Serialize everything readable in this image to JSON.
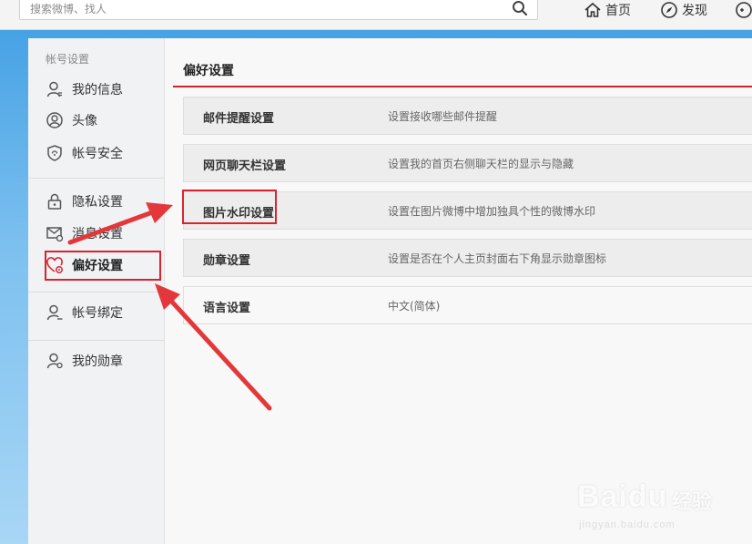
{
  "topbar": {
    "search_placeholder": "搜索微博、找人",
    "nav": [
      {
        "label": "首页",
        "icon": "home-icon"
      },
      {
        "label": "发现",
        "icon": "compass-icon"
      },
      {
        "label": "",
        "icon": "gamepad-icon"
      }
    ]
  },
  "sidebar": {
    "group_title": "帐号设置",
    "items": [
      {
        "label": "我的信息",
        "icon": "user-icon"
      },
      {
        "label": "头像",
        "icon": "avatar-icon"
      },
      {
        "label": "帐号安全",
        "icon": "shield-icon"
      },
      {
        "label": "隐私设置",
        "icon": "lock-icon"
      },
      {
        "label": "消息设置",
        "icon": "mail-gear-icon"
      },
      {
        "label": "偏好设置",
        "icon": "heart-gear-icon"
      },
      {
        "label": "帐号绑定",
        "icon": "user-link-icon"
      },
      {
        "label": "我的勋章",
        "icon": "medal-icon"
      }
    ]
  },
  "main": {
    "title": "偏好设置",
    "rows": [
      {
        "name": "邮件提醒设置",
        "desc": "设置接收哪些邮件提醒"
      },
      {
        "name": "网页聊天栏设置",
        "desc": "设置我的首页右侧聊天栏的显示与隐藏"
      },
      {
        "name": "图片水印设置",
        "desc": "设置在图片微博中增加独具个性的微博水印"
      },
      {
        "name": "勋章设置",
        "desc": "设置是否在个人主页封面右下角显示勋章图标"
      },
      {
        "name": "语言设置",
        "desc": "中文(简体)"
      }
    ]
  },
  "colors": {
    "highlight": "#d8232f",
    "title_rule": "#c9262c",
    "background": "#4aa6e6"
  },
  "watermark": {
    "brand": "Baidu",
    "brand_cn": "经验",
    "url": "jingyan.baidu.com"
  }
}
